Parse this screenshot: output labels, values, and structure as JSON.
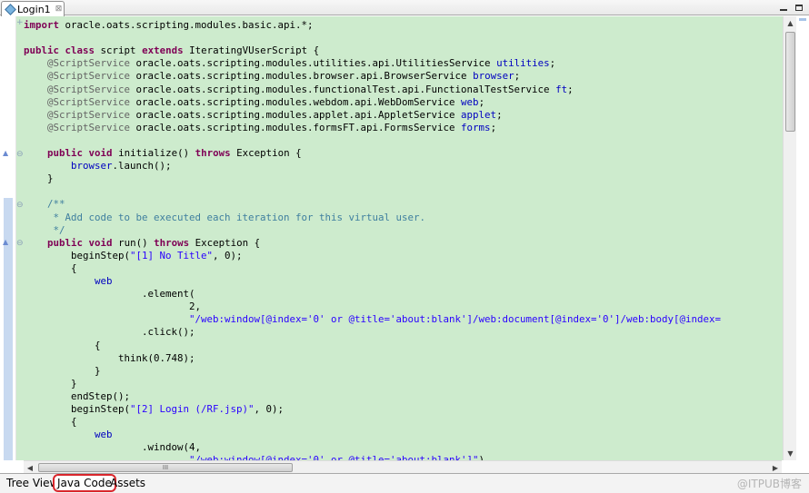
{
  "editor_tab": {
    "title": "Login1",
    "close_glyph": "⊠"
  },
  "window_controls": {
    "minimize": "minimize-icon",
    "maximize": "maximize-icon"
  },
  "code_lines": [
    {
      "t": "import oracle.oats.scripting.modules.basic.api.*;"
    },
    {
      "t": ""
    },
    {
      "t": "public class script extends IteratingVUserScript {"
    },
    {
      "t": "    @ScriptService oracle.oats.scripting.modules.utilities.api.UtilitiesService utilities;"
    },
    {
      "t": "    @ScriptService oracle.oats.scripting.modules.browser.api.BrowserService browser;"
    },
    {
      "t": "    @ScriptService oracle.oats.scripting.modules.functionalTest.api.FunctionalTestService ft;"
    },
    {
      "t": "    @ScriptService oracle.oats.scripting.modules.webdom.api.WebDomService web;"
    },
    {
      "t": "    @ScriptService oracle.oats.scripting.modules.applet.api.AppletService applet;"
    },
    {
      "t": "    @ScriptService oracle.oats.scripting.modules.formsFT.api.FormsService forms;"
    },
    {
      "t": ""
    },
    {
      "t": "    public void initialize() throws Exception {"
    },
    {
      "t": "        browser.launch();"
    },
    {
      "t": "    }"
    },
    {
      "t": ""
    },
    {
      "t": "    /**"
    },
    {
      "t": "     * Add code to be executed each iteration for this virtual user."
    },
    {
      "t": "     */"
    },
    {
      "t": "    public void run() throws Exception {"
    },
    {
      "t": "        beginStep(\"[1] No Title\", 0);"
    },
    {
      "t": "        {"
    },
    {
      "t": "            web"
    },
    {
      "t": "                    .element("
    },
    {
      "t": "                            2,"
    },
    {
      "t": "                            \"/web:window[@index='0' or @title='about:blank']/web:document[@index='0']/web:body[@index="
    },
    {
      "t": "                    .click();"
    },
    {
      "t": "            {"
    },
    {
      "t": "                think(0.748);"
    },
    {
      "t": "            }"
    },
    {
      "t": "        }"
    },
    {
      "t": "        endStep();"
    },
    {
      "t": "        beginStep(\"[2] Login (/RF.jsp)\", 0);"
    },
    {
      "t": "        {"
    },
    {
      "t": "            web"
    },
    {
      "t": "                    .window(4,"
    },
    {
      "t": "                            \"/web:window[@index='0' or @title='about:blank']\")"
    }
  ],
  "hscroll": {
    "thumb_grip": "III"
  },
  "bottom_tabs": [
    {
      "label": "Tree View",
      "active": false
    },
    {
      "label": "Java Code",
      "active": true
    },
    {
      "label": "Assets",
      "active": false
    }
  ],
  "watermark": "@ITPUB博客"
}
